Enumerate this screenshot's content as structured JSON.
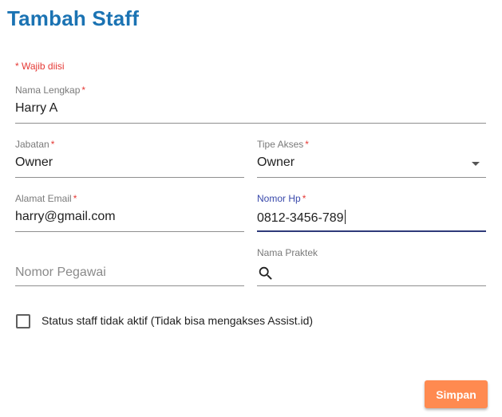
{
  "page": {
    "title": "Tambah Staff"
  },
  "form": {
    "required_note": "* Wajib diisi",
    "nama_lengkap": {
      "label": "Nama Lengkap",
      "required_mark": "*",
      "value": "Harry A"
    },
    "jabatan": {
      "label": "Jabatan",
      "required_mark": "*",
      "value": "Owner"
    },
    "tipe_akses": {
      "label": "Tipe Akses",
      "required_mark": "*",
      "value": "Owner",
      "icon": "dropdown-arrow-icon"
    },
    "alamat_email": {
      "label": "Alamat Email",
      "required_mark": "*",
      "value": "harry@gmail.com"
    },
    "nomor_hp": {
      "label": "Nomor Hp",
      "required_mark": "*",
      "value": "0812-3456-789",
      "focused": true
    },
    "nomor_pegawai": {
      "placeholder": "Nomor Pegawai"
    },
    "nama_praktek": {
      "label": "Nama Praktek",
      "icon": "search-icon"
    },
    "status_checkbox": {
      "label": "Status staff tidak aktif (Tidak bisa mengakses Assist.id)",
      "checked": false
    },
    "save_label": "Simpan"
  },
  "colors": {
    "title": "#1b73b3",
    "required": "#e53935",
    "focus_label": "#3949ab",
    "focus_underline": "#2e3a7a",
    "save_button": "#ff8a50"
  }
}
